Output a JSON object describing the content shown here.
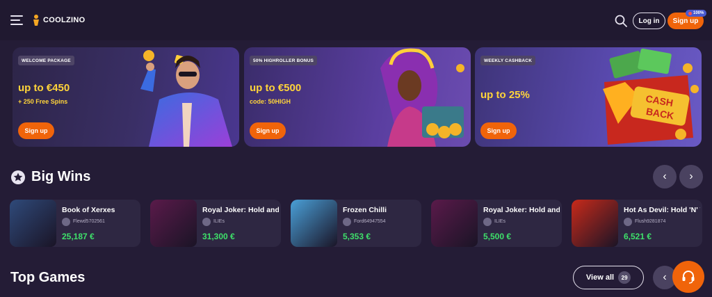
{
  "header": {
    "logo_text": "COOLZINO",
    "login_label": "Log in",
    "signup_label": "Sign up",
    "signup_badge": "100%"
  },
  "promos": [
    {
      "tag": "WELCOME PACKAGE",
      "amount": "up to €450",
      "sub": "+ 250 Free Spins",
      "button": "Sign up"
    },
    {
      "tag": "50% HIGHROLLER BONUS",
      "amount": "up to €500",
      "sub": "code: 50HIGH",
      "button": "Sign up"
    },
    {
      "tag": "WEEKLY CASHBACK",
      "amount": "up to 25%",
      "sub": "",
      "button": "Sign up"
    }
  ],
  "big_wins": {
    "title": "Big Wins",
    "items": [
      {
        "game": "Book of Xerxes",
        "user": "Flewd5702561",
        "amount": "25,187 €",
        "thumb_color": "#2f4a7a"
      },
      {
        "game": "Royal Joker: Hold and Win",
        "user": "ILIEs",
        "amount": "31,300 €",
        "thumb_color": "#5a1a4a"
      },
      {
        "game": "Frozen Chilli",
        "user": "Ford64947554",
        "amount": "5,353 €",
        "thumb_color": "#4aa0d8"
      },
      {
        "game": "Royal Joker: Hold and Win",
        "user": "ILIEs",
        "amount": "5,500 €",
        "thumb_color": "#5a1a4a"
      },
      {
        "game": "Hot As Devil: Hold 'N' Win",
        "user": "Flush9281874",
        "amount": "6,521 €",
        "thumb_color": "#c82a1a"
      }
    ]
  },
  "top_games": {
    "title": "Top Games",
    "view_all_label": "View all",
    "view_all_count": "29"
  },
  "colors": {
    "accent": "#f0640a",
    "promo_text": "#ffd43a",
    "win_amount": "#3ee06a",
    "background": "#241c36"
  }
}
